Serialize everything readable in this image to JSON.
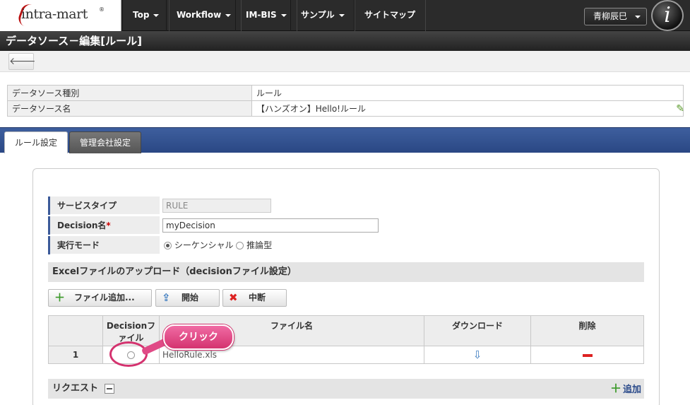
{
  "nav": {
    "logo": "intra-mart",
    "logo_mark": "®",
    "items": [
      "Top",
      "Workflow",
      "IM-BIS",
      "サンプル",
      "サイトマップ"
    ],
    "user": "青柳辰巳",
    "info_glyph": "i"
  },
  "page": {
    "title": "データソース－編集[ルール]"
  },
  "toolbar": {
    "back_glyph": "🡐"
  },
  "info": {
    "rows": [
      {
        "key": "データソース種別",
        "value": "ルール"
      },
      {
        "key": "データソース名",
        "value": "【ハンズオン】Hello!ルール"
      }
    ]
  },
  "tabs": [
    {
      "label": "ルール設定",
      "active": true
    },
    {
      "label": "管理会社設定",
      "active": false
    }
  ],
  "form": {
    "service_type_label": "サービスタイプ",
    "service_type_value": "RULE",
    "decision_name_label": "Decision名",
    "required_mark": "*",
    "decision_name_value": "myDecision",
    "exec_mode_label": "実行モード",
    "exec_mode_options": [
      "シーケンシャル",
      "推論型"
    ],
    "exec_mode_selected": "シーケンシャル"
  },
  "upload": {
    "section_title": "Excelファイルのアップロード（decisionファイル設定）",
    "add_button": "ファイル追加...",
    "start_button": "開始",
    "stop_button": "中断"
  },
  "file_table": {
    "headers": [
      "",
      "Decisionファイル",
      "ファイル名",
      "ダウンロード",
      "削除"
    ],
    "rows": [
      {
        "num": "1",
        "filename": "HelloRule.xls"
      }
    ]
  },
  "callout": {
    "label": "クリック"
  },
  "request": {
    "title": "リクエスト",
    "add_label": "追加"
  },
  "colors": {
    "nav_bg": "#2b2b2b",
    "tab_bar": "#2a4784",
    "accent_pink": "#d4336f"
  }
}
